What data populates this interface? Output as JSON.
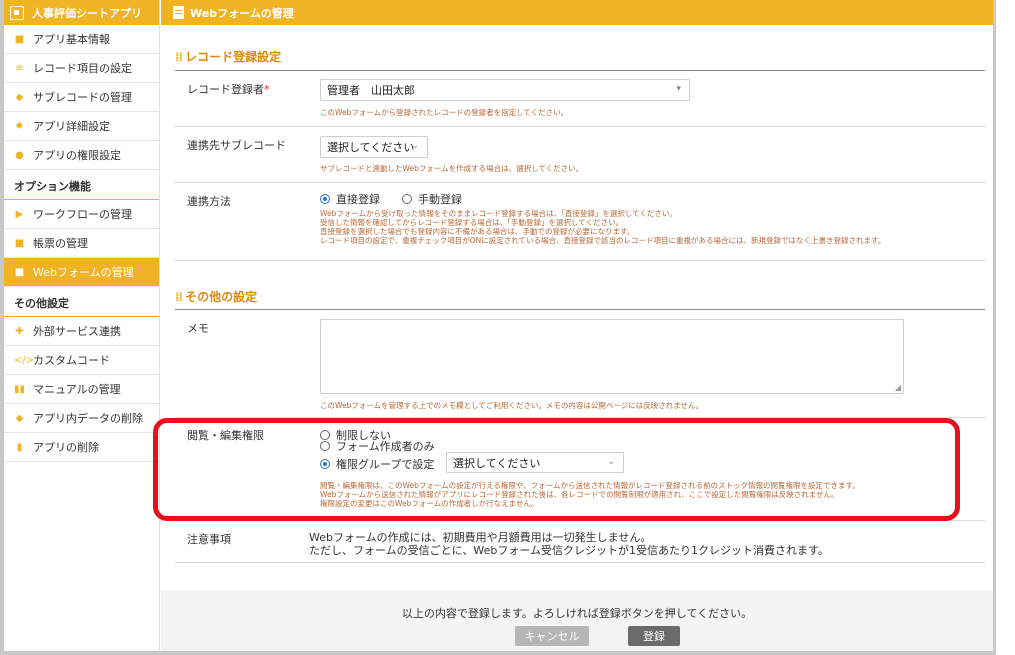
{
  "sidebar": {
    "app_title": "人事評価シートアプリ",
    "items": [
      {
        "label": "アプリ基本情報",
        "icon": "■"
      },
      {
        "label": "レコード項目の設定",
        "icon": "≡"
      },
      {
        "label": "サブレコードの管理",
        "icon": "◆"
      },
      {
        "label": "アプリ詳細設定",
        "icon": "✹"
      },
      {
        "label": "アプリの権限設定",
        "icon": "●"
      }
    ],
    "option_section": "オプション機能",
    "option_items": [
      {
        "label": "ワークフローの管理",
        "icon": "▶"
      },
      {
        "label": "帳票の管理",
        "icon": "■"
      },
      {
        "label": "Webフォームの管理",
        "icon": "■"
      }
    ],
    "other_section": "その他設定",
    "other_items": [
      {
        "label": "外部サービス連携",
        "icon": "✚"
      },
      {
        "label": "カスタムコード",
        "icon": "</>"
      },
      {
        "label": "マニュアルの管理",
        "icon": "▮▮"
      },
      {
        "label": "アプリ内データの削除",
        "icon": "◆"
      },
      {
        "label": "アプリの削除",
        "icon": "▮"
      }
    ]
  },
  "header": {
    "title": "Webフォームの管理"
  },
  "record_section": {
    "title": "レコード登録設定",
    "registrant": {
      "label": "レコード登録者",
      "required_mark": "*",
      "value": "管理者　山田太郎",
      "note": "このWebフォームから登録されたレコードの登録者を指定してください。"
    },
    "subrecord": {
      "label": "連携先サブレコード",
      "value": "選択してください",
      "note": "サブレコードと連動したWebフォームを作成する場合は、選択してください。"
    },
    "method": {
      "label": "連携方法",
      "options": [
        "直接登録",
        "手動登録"
      ],
      "selected": "直接登録",
      "notes": [
        "Webフォームから受け取った情報をそのままレコード登録する場合は、「直接登録」を選択してください。",
        "受信した情報を確認してからレコード登録する場合は、「手動登録」を選択してください。",
        "直接登録を選択した場合でも登録内容に不備がある場合は、手動での登録が必要になります。",
        "レコード項目の設定で、重複チェック項目がONに設定されている場合、直接登録で該当のレコード項目に重複がある場合には、新規登録ではなく上書き登録されます。"
      ]
    }
  },
  "other_section": {
    "title": "その他の設定",
    "memo": {
      "label": "メモ",
      "value": "",
      "note": "このWebフォームを管理する上でのメモ欄としてご利用ください。メモの内容は公開ページには反映されません。"
    },
    "permission": {
      "label": "閲覧・編集権限",
      "options": [
        "制限しない",
        "フォーム作成者のみ",
        "権限グループで設定"
      ],
      "selected": "権限グループで設定",
      "colon": "：",
      "group_value": "選択してください",
      "notes": [
        "閲覧・編集権限は、このWebフォームの設定が行える権限や、フォームから送信された情報がレコード登録される前のストック情報の閲覧権限を設定できます。",
        "Webフォームから送信された情報がアプリにレコード登録された後は、各レコードでの閲覧制限が適用され、ここで設定した閲覧権限は反映されません。",
        "権限設定の変更はこのWebフォームの作成者しか行なえません。"
      ]
    },
    "caution": {
      "label": "注意事項",
      "lines": [
        "Webフォームの作成には、初期費用や月額費用は一切発生しません。",
        "ただし、フォームの受信ごとに、Webフォーム受信クレジットが1受信あたり1クレジット消費されます。"
      ]
    }
  },
  "footer": {
    "message": "以上の内容で登録します。よろしければ登録ボタンを押してください。",
    "cancel_label": "キャンセル",
    "submit_label": "登録"
  },
  "colors": {
    "accent": "#f0b323",
    "section_title": "#e08a0e",
    "note": "#b7693a",
    "highlight": "#e8101a",
    "radio": "#2a6fd6"
  }
}
